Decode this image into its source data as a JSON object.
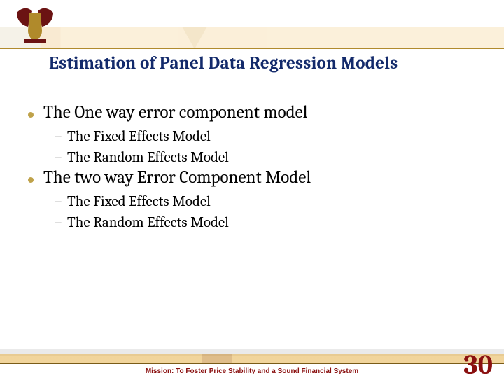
{
  "title": "Estimation of Panel Data Regression Models",
  "bullets": [
    {
      "text": "The One way error component model",
      "subs": [
        "The Fixed Effects Model",
        "The Random Effects Model"
      ]
    },
    {
      "text": "The two way Error Component Model",
      "subs": [
        "The Fixed Effects Model",
        "The Random Effects Model"
      ]
    }
  ],
  "mission": "Mission: To Foster Price Stability and a Sound Financial System",
  "page_number": "30"
}
